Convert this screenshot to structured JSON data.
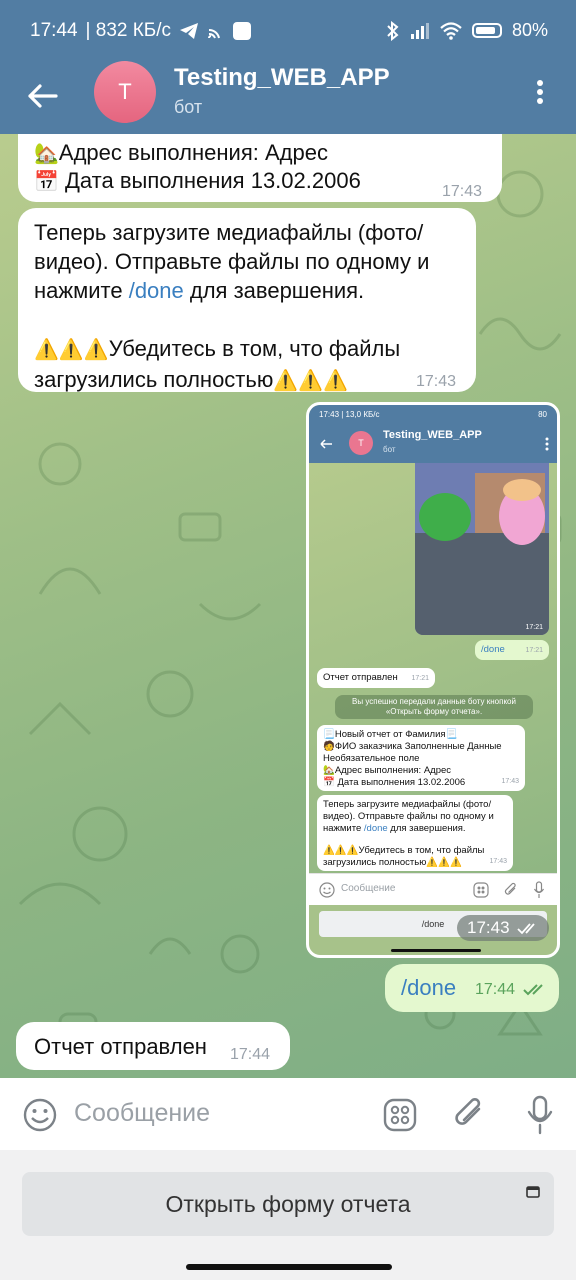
{
  "status_bar": {
    "time": "17:44",
    "speed": "| 832 КБ/с",
    "battery": "80%"
  },
  "header": {
    "avatar_letter": "T",
    "title": "Testing_WEB_APP",
    "subtitle": "бот"
  },
  "messages": {
    "m1": {
      "line1": "Адрес выполнения: Адрес",
      "line2": "Дата выполнения 13.02.2006",
      "time": "17:43"
    },
    "m2": {
      "text1": "Теперь загрузите медиафайлы (фото/видео). Отправьте файлы по одному и нажмите ",
      "link": "/done",
      "text2": " для завершения.",
      "warning": "Убедитесь в том, что файлы загрузились полностью",
      "time": "17:43"
    },
    "screenshot": {
      "time": "17:43",
      "inner": {
        "status_time": "17:43 | 13,0 КБ/с",
        "status_battery": "80",
        "avatar_letter": "T",
        "title": "Testing_WEB_APP",
        "subtitle": "бот",
        "image_time": "17:21",
        "done_text": "/done",
        "done_time": "17:21",
        "sent_text": "Отчет отправлен",
        "sent_time": "17:21",
        "service_line1": "Вы успешно передали данные боту кнопкой",
        "service_line2": "«Открыть форму отчета».",
        "report_line1": "Новый отчет от Фамилия",
        "report_line2": "ФИО заказчика Заполненные Данные",
        "report_line3": "Необязательное поле",
        "report_line4": "Адрес выполнения: Адрес",
        "report_line5": "Дата выполнения 13.02.2006",
        "report_time": "17:43",
        "media_text1": "Теперь загрузите медиафайлы (фото/видео). Отправьте файлы по одному и нажмите ",
        "media_link": "/done",
        "media_text2": " для завершения.",
        "media_warning": "Убедитесь в том, что файлы загрузились полностью",
        "media_time": "17:43",
        "input_placeholder": "Сообщение",
        "form_button": "/done"
      }
    },
    "m3": {
      "text": "/done",
      "time": "17:44"
    },
    "m4": {
      "text": "Отчет отправлен",
      "time": "17:44"
    }
  },
  "input": {
    "placeholder": "Сообщение"
  },
  "form_button": {
    "label": "Открыть форму отчета"
  },
  "icons": {
    "back": "back-arrow-icon",
    "menu": "more-vertical-icon",
    "emoji": "smiley-icon",
    "apps": "bot-menu-icon",
    "attach": "paperclip-icon",
    "mic": "microphone-icon",
    "webapp": "window-icon"
  },
  "colors": {
    "header": "#527da3",
    "outgoing_bubble": "#e4f8cf",
    "link": "#3a7fc0",
    "avatar": "#e5657f"
  }
}
